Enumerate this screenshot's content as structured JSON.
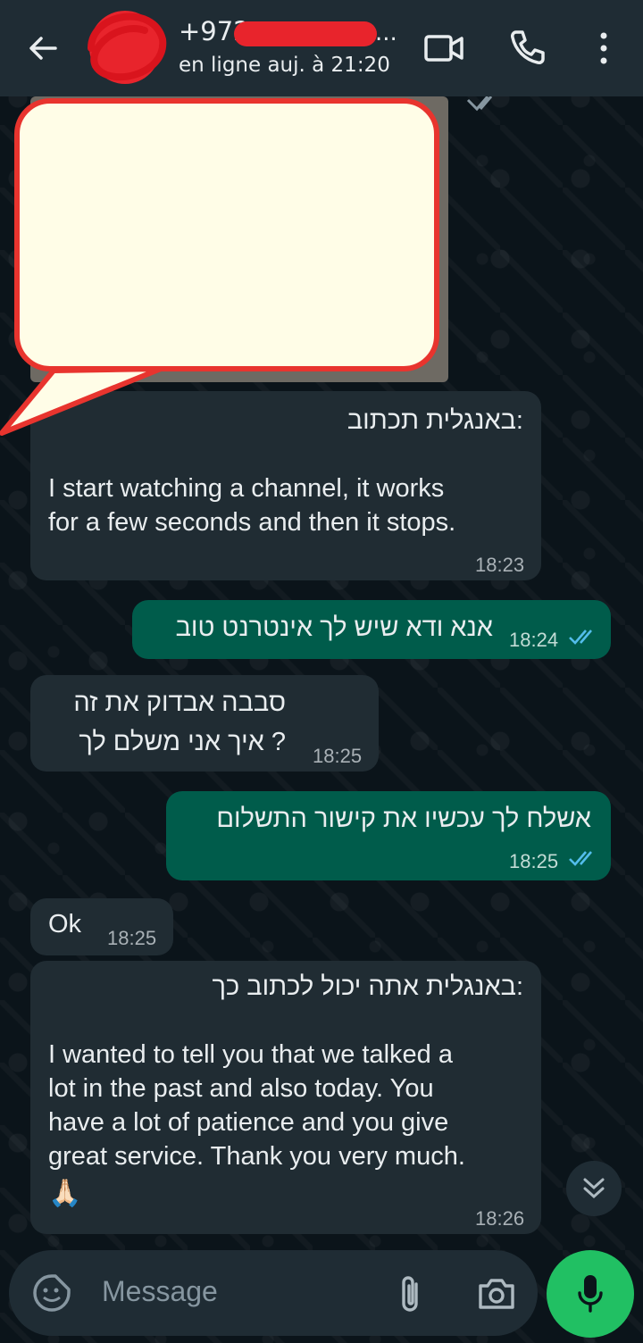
{
  "header": {
    "contact_name": "+972",
    "name_ellipsis": "...",
    "status": "en ligne auj. à 21:20"
  },
  "messages": [
    {
      "id": "m1",
      "direction": "in",
      "lines": [
        ":באנגלית תכתוב",
        "",
        "I start watching a channel, it works",
        "for a few seconds and then it stops."
      ],
      "time": "18:23"
    },
    {
      "id": "m2",
      "direction": "out",
      "lines": [
        "אנא ודא שיש לך אינטרנט טוב"
      ],
      "time": "18:24"
    },
    {
      "id": "m3",
      "direction": "in",
      "lines": [
        "סבבה אבדוק את זה",
        "? איך אני משלם לך"
      ],
      "time": "18:25"
    },
    {
      "id": "m4",
      "direction": "out",
      "lines": [
        "אשלח לך עכשיו את קישור התשלום"
      ],
      "time": "18:25"
    },
    {
      "id": "m5",
      "direction": "in",
      "lines": [
        "Ok"
      ],
      "time": "18:25"
    },
    {
      "id": "m6",
      "direction": "in",
      "lines": [
        ":באנגלית אתה יכול לכתוב כך",
        "",
        "I wanted to tell you that we talked a",
        "lot in the past and also today. You",
        "have a lot of patience and you give",
        "great service. Thank you very much.",
        "🙏🏻"
      ],
      "time": "18:26"
    }
  ],
  "composer": {
    "placeholder": "Message"
  },
  "colors": {
    "header_bg": "#1f2c34",
    "incoming_bubble": "#202c33",
    "outgoing_bubble": "#005c4b",
    "accent_green": "#21c063",
    "read_ticks": "#53bdeb",
    "redaction_red": "#e8242c"
  },
  "icons": [
    "back-arrow-icon",
    "video-call-icon",
    "phone-icon",
    "more-options-icon",
    "double-check-icon",
    "emoji-sticker-icon",
    "attach-icon",
    "camera-icon",
    "mic-icon",
    "scroll-down-icon"
  ]
}
